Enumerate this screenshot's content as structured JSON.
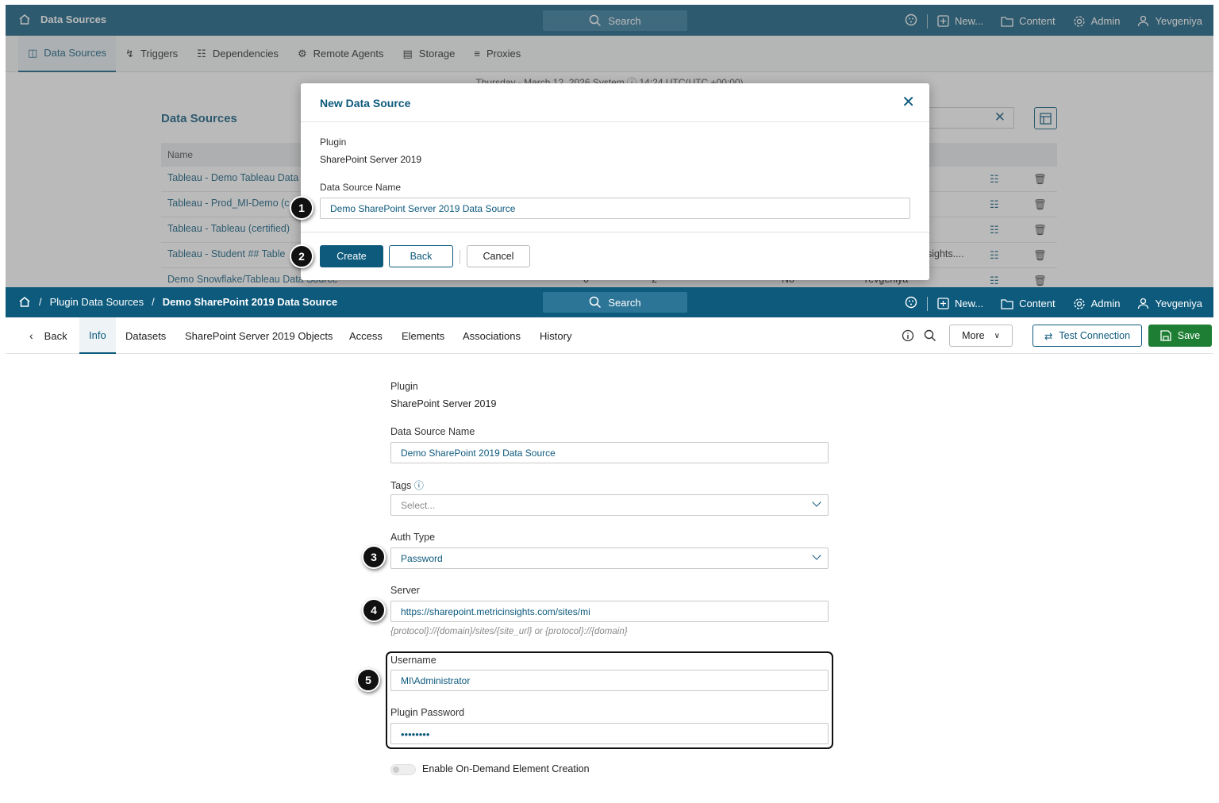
{
  "top": {
    "title": "Data Sources",
    "search_label": "Search",
    "nav": {
      "new": "New...",
      "content": "Content",
      "admin": "Admin",
      "user": "Yevgeniya"
    },
    "subnav": [
      "Data Sources",
      "Triggers",
      "Dependencies",
      "Remote Agents",
      "Storage",
      "Proxies"
    ],
    "timestamp": "Thursday - March 12, 2026 System  ⓘ  14:24 UTC(UTC +00:00)"
  },
  "bg_table": {
    "title": "Data Sources",
    "col_name": "Name",
    "rows": [
      "Tableau - Demo Tableau Data",
      "Tableau - Prod_MI-Demo (c",
      "Tableau - Tableau (certified)",
      "Tableau - Student ## Table",
      "Demo Snowflake/Tableau Data Source"
    ],
    "partial_row_text": "sights....",
    "last_row": {
      "col2": "0",
      "col3": "2",
      "col4": "No",
      "col5": "Yevgeniya"
    }
  },
  "modal": {
    "title": "New Data Source",
    "plugin_label": "Plugin",
    "plugin_value": "SharePoint Server 2019",
    "name_label": "Data Source Name",
    "name_value": "Demo SharePoint Server 2019 Data Source",
    "create": "Create",
    "back": "Back",
    "cancel": "Cancel"
  },
  "badges": [
    "1",
    "2",
    "3",
    "4",
    "5"
  ],
  "bottom": {
    "crumb_parent": "Plugin Data Sources",
    "crumb_current": "Demo SharePoint 2019 Data Source",
    "search_label": "Search",
    "nav": {
      "new": "New...",
      "content": "Content",
      "admin": "Admin",
      "user": "Yevgeniya"
    },
    "tabs": [
      "Back",
      "Info",
      "Datasets",
      "SharePoint Server 2019 Objects",
      "Access",
      "Elements",
      "Associations",
      "History"
    ],
    "more": "More",
    "test_connection": "Test Connection",
    "save": "Save"
  },
  "form": {
    "plugin_label": "Plugin",
    "plugin_value": "SharePoint Server 2019",
    "name_label": "Data Source Name",
    "name_value": "Demo SharePoint 2019 Data Source",
    "tags_label": "Tags",
    "tags_placeholder": "Select...",
    "auth_label": "Auth Type",
    "auth_value": "Password",
    "server_label": "Server",
    "server_value": "https://sharepoint.metricinsights.com/sites/mi",
    "server_hint": "{protocol}://{domain}/sites/{site_url} or {protocol}://{domain}",
    "username_label": "Username",
    "username_value": "MI\\Administrator",
    "password_label": "Plugin Password",
    "password_value": "••••••••",
    "on_demand_label": "Enable On-Demand Element Creation"
  },
  "colors": {
    "brand": "#0d5a7d",
    "save": "#1e7e34"
  }
}
